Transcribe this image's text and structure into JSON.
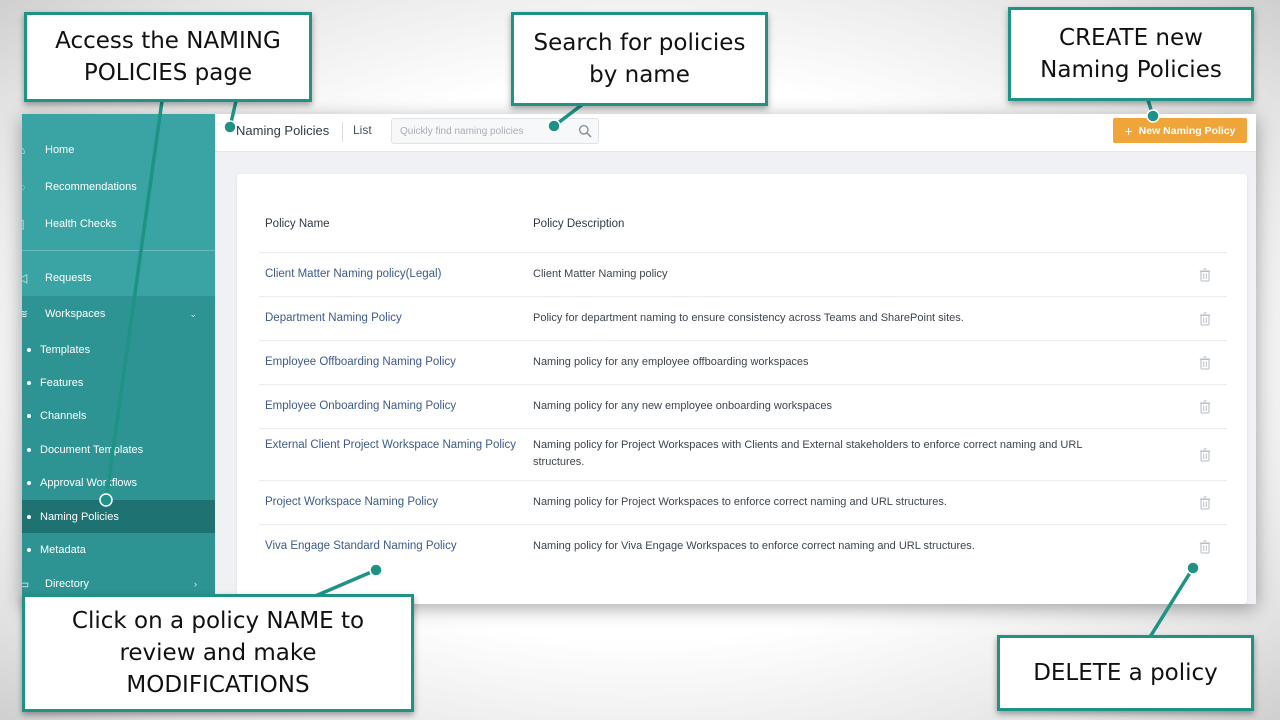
{
  "sidebar": {
    "items": [
      {
        "label": "Home",
        "icon": "home-icon"
      },
      {
        "label": "Recommendations",
        "icon": "lightbulb-icon"
      },
      {
        "label": "Health Checks",
        "icon": "clipboard-icon"
      },
      {
        "label": "Requests",
        "icon": "send-icon"
      },
      {
        "label": "Workspaces",
        "icon": "layers-icon"
      }
    ],
    "sub_items": [
      {
        "label": "Templates"
      },
      {
        "label": "Features"
      },
      {
        "label": "Channels"
      },
      {
        "label": "Document Templates"
      },
      {
        "label": "Approval Workflows"
      },
      {
        "label": "Naming Policies"
      },
      {
        "label": "Metadata"
      }
    ],
    "directory_label": "Directory"
  },
  "topbar": {
    "title": "Naming Policies",
    "view": "List",
    "search_placeholder": "Quickly find naming policies",
    "new_button_label": "New Naming Policy"
  },
  "table": {
    "headers": [
      "Policy Name",
      "Policy Description"
    ],
    "rows": [
      {
        "name": "Client Matter Naming policy(Legal)",
        "description": "Client Matter Naming policy"
      },
      {
        "name": "Department Naming Policy",
        "description": "Policy for department naming to ensure consistency across Teams and SharePoint sites."
      },
      {
        "name": "Employee Offboarding Naming Policy",
        "description": "Naming policy for any employee offboarding workspaces"
      },
      {
        "name": "Employee Onboarding Naming Policy",
        "description": "Naming policy for any new employee onboarding workspaces"
      },
      {
        "name": "External Client Project Workspace Naming Policy",
        "description": "Naming policy for Project Workspaces with Clients and External stakeholders to enforce correct naming and URL structures."
      },
      {
        "name": "Project Workspace Naming Policy",
        "description": "Naming policy for Project Workspaces to enforce correct naming and URL structures."
      },
      {
        "name": "Viva Engage Standard Naming Policy",
        "description": "Naming policy for Viva Engage Workspaces to enforce correct naming and URL structures."
      }
    ]
  },
  "callouts": {
    "access": "Access the NAMING\nPOLICIES page",
    "search": "Search for policies\nby name",
    "create": "CREATE new\nNaming Policies",
    "click_name": "Click on a policy NAME to\nreview and make\nMODIFICATIONS",
    "delete": "DELETE a policy"
  },
  "colors": {
    "sidebar": "#3aa3a3",
    "sidebar_sub": "#2d9393",
    "sidebar_active": "#1e7272",
    "accent_button": "#f0a53a",
    "callout_border": "#1e9385",
    "link": "#3d5a8a"
  }
}
